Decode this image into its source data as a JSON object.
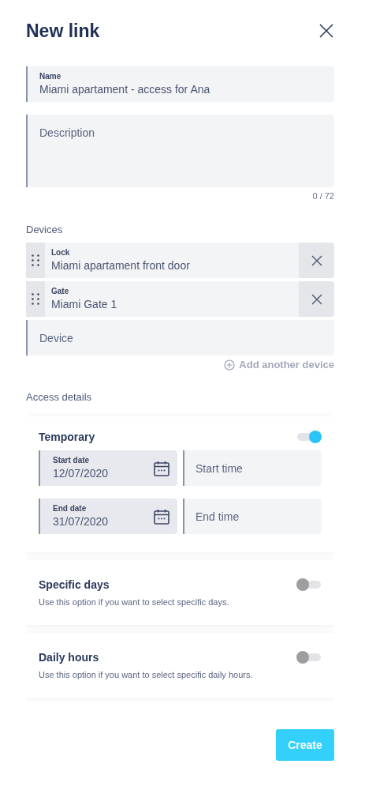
{
  "title": "New link",
  "name_field": {
    "label": "Name",
    "value": "Miami apartament - access for Ana"
  },
  "description_field": {
    "placeholder": "Description",
    "counter": "0 / 72"
  },
  "devices_heading": "Devices",
  "devices": [
    {
      "type": "Lock",
      "name": "Miami apartament front door"
    },
    {
      "type": "Gate",
      "name": "Miami Gate 1"
    }
  ],
  "device_field": {
    "placeholder": "Device"
  },
  "add_device": "Add another device",
  "access_heading": "Access details",
  "options": [
    {
      "kind": "dates",
      "title": "Temporary",
      "on": true,
      "rows": [
        {
          "label": "Start date",
          "value": "12/07/2020",
          "time_placeholder": "Start time"
        },
        {
          "label": "End date",
          "value": "31/07/2020",
          "time_placeholder": "End time"
        }
      ]
    },
    {
      "kind": "plain",
      "title": "Specific days",
      "description": "Use this option if you want to select specific days.",
      "on": false
    },
    {
      "kind": "plain",
      "title": "Daily hours",
      "description": "Use this option if you want to select specific daily hours.",
      "on": false
    }
  ],
  "create_button": "Create"
}
